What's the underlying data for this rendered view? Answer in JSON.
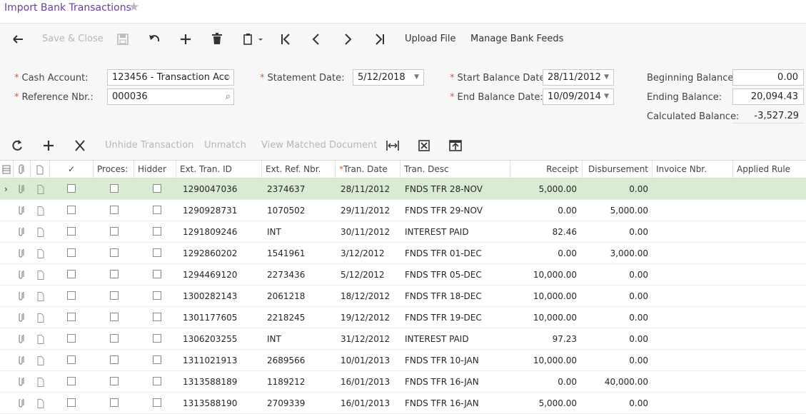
{
  "page": {
    "title": "Import Bank Transactions"
  },
  "toolbar": {
    "save_close": "Save & Close",
    "upload_file": "Upload File",
    "manage_feeds": "Manage Bank Feeds"
  },
  "form": {
    "cash_account": {
      "label": "Cash Account:",
      "value": "123456 - Transaction Acc"
    },
    "reference_nbr": {
      "label": "Reference Nbr.:",
      "value": "000036"
    },
    "statement_date": {
      "label": "Statement Date:",
      "value": "5/12/2018"
    },
    "start_balance_date": {
      "label": "Start Balance Date:",
      "value": "28/11/2012"
    },
    "end_balance_date": {
      "label": "End Balance Date:",
      "value": "10/09/2014"
    },
    "beginning_balance": {
      "label": "Beginning Balance:",
      "value": "0.00"
    },
    "ending_balance": {
      "label": "Ending Balance:",
      "value": "20,094.43"
    },
    "calculated_balance": {
      "label": "Calculated Balance:",
      "value": "-3,527.29"
    }
  },
  "gridbar": {
    "unhide": "Unhide Transaction",
    "unmatch": "Unmatch",
    "view_matched": "View Matched Document"
  },
  "columns": {
    "check": "✓",
    "processed": "Proces:",
    "hidden": "Hidder",
    "ext_tran_id": "Ext. Tran. ID",
    "ext_ref_nbr": "Ext. Ref. Nbr.",
    "tran_date": "Tran. Date",
    "tran_desc": "Tran. Desc",
    "receipt": "Receipt",
    "disbursement": "Disbursement",
    "invoice_nbr": "Invoice Nbr.",
    "applied_rule": "Applied Rule"
  },
  "rows": [
    {
      "ext_tran_id": "1290047036",
      "ext_ref_nbr": "2374637",
      "tran_date": "28/11/2012",
      "tran_desc": "FNDS TFR 28-NOV",
      "receipt": "5,000.00",
      "disbursement": "0.00"
    },
    {
      "ext_tran_id": "1290928731",
      "ext_ref_nbr": "1070502",
      "tran_date": "29/11/2012",
      "tran_desc": "FNDS TFR 29-NOV",
      "receipt": "0.00",
      "disbursement": "5,000.00"
    },
    {
      "ext_tran_id": "1291809246",
      "ext_ref_nbr": "INT",
      "tran_date": "30/11/2012",
      "tran_desc": "INTEREST PAID",
      "receipt": "82.46",
      "disbursement": "0.00"
    },
    {
      "ext_tran_id": "1292860202",
      "ext_ref_nbr": "1541961",
      "tran_date": "3/12/2012",
      "tran_desc": "FNDS TFR 01-DEC",
      "receipt": "0.00",
      "disbursement": "3,000.00"
    },
    {
      "ext_tran_id": "1294469120",
      "ext_ref_nbr": "2273436",
      "tran_date": "5/12/2012",
      "tran_desc": "FNDS TFR 05-DEC",
      "receipt": "10,000.00",
      "disbursement": "0.00"
    },
    {
      "ext_tran_id": "1300282143",
      "ext_ref_nbr": "2061218",
      "tran_date": "18/12/2012",
      "tran_desc": "FNDS TFR 18-DEC",
      "receipt": "10,000.00",
      "disbursement": "0.00"
    },
    {
      "ext_tran_id": "1301177605",
      "ext_ref_nbr": "2218245",
      "tran_date": "19/12/2012",
      "tran_desc": "FNDS TFR 19-DEC",
      "receipt": "10,000.00",
      "disbursement": "0.00"
    },
    {
      "ext_tran_id": "1306203255",
      "ext_ref_nbr": "INT",
      "tran_date": "31/12/2012",
      "tran_desc": "INTEREST PAID",
      "receipt": "97.23",
      "disbursement": "0.00"
    },
    {
      "ext_tran_id": "1311021913",
      "ext_ref_nbr": "2689566",
      "tran_date": "10/01/2013",
      "tran_desc": "FNDS TFR 10-JAN",
      "receipt": "10,000.00",
      "disbursement": "0.00"
    },
    {
      "ext_tran_id": "1313588189",
      "ext_ref_nbr": "1189212",
      "tran_date": "16/01/2013",
      "tran_desc": "FNDS TFR 16-JAN",
      "receipt": "0.00",
      "disbursement": "40,000.00"
    },
    {
      "ext_tran_id": "1313588190",
      "ext_ref_nbr": "2709339",
      "tran_date": "16/01/2013",
      "tran_desc": "FNDS TFR 16-JAN",
      "receipt": "5,000.00",
      "disbursement": "0.00"
    }
  ],
  "colors": {
    "title": "#6b3fa0",
    "required": "#e05a2b",
    "selected_row": "#d9ecd3",
    "panel": "#f7f7f7"
  }
}
